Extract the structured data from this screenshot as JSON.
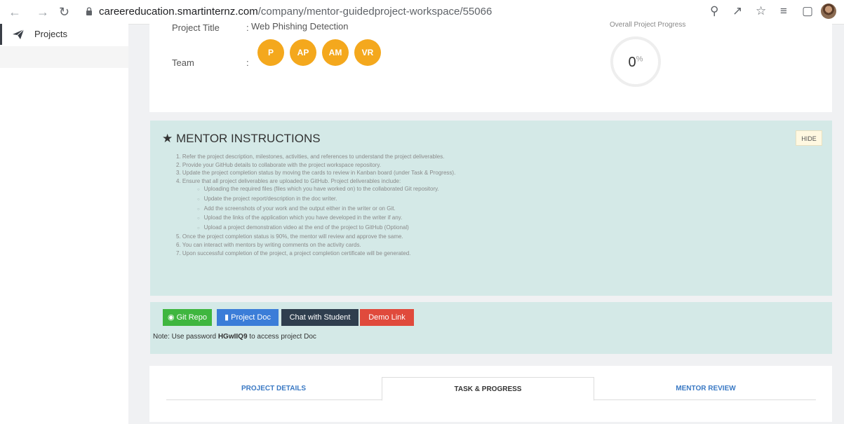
{
  "browser": {
    "url_host": "careereducation.smartinternz.com",
    "url_path": "/company/mentor-guidedproject-workspace/55066",
    "back_icon": "arrow-left-icon",
    "forward_icon": "arrow-right-icon",
    "reload_icon": "reload-icon"
  },
  "sidebar": {
    "items": [
      {
        "label": "Projects",
        "icon": "paper-plane-icon"
      }
    ]
  },
  "project": {
    "title_label": "Project Title",
    "title_value": "Web Phishing Detection",
    "team_label": "Team",
    "colon": ":",
    "team": [
      "P",
      "AP",
      "AM",
      "VR"
    ],
    "progress_label": "Overall Project Progress",
    "progress_value": "0",
    "progress_unit": "%",
    "progress_fraction": 0
  },
  "mentor": {
    "heading": "MENTOR INSTRUCTIONS",
    "hide_label": "HIDE",
    "items": [
      "1. Refer the project description, milestones, activities, and references to understand the project deliverables.",
      "2. Provide your GitHub details to collaborate with the project workspace repository.",
      "3. Update the project completion status by moving the cards to review in Kanban board (under Task & Progress).",
      "4. Ensure that all project deliverables are uploaded to GitHub. Project deliverables include:"
    ],
    "bullets": [
      "Uploading the required files (files which you have worked on) to the collaborated Git repository.",
      "Update the project report/description in the doc writer.",
      "Add the screenshots of your work and the output either in the writer or on Git.",
      "Upload the links of the application which you have developed in the writer if any.",
      "Upload a project demonstration video at the end of the project to GitHub (Optional)"
    ],
    "items_after": [
      "5. Once the project completion status is 90%, the mentor will review and approve the same.",
      "6. You can interact with mentors by writing comments on the activity cards.",
      "7. Upon successful completion of the project, a project completion certificate will be generated."
    ]
  },
  "links": {
    "git_repo": "Git Repo",
    "project_doc": "Project Doc",
    "chat": "Chat with Student",
    "demo": "Demo Link",
    "note_prefix": "Note: Use password",
    "password": "HGwIIQ9",
    "note_suffix": "to access project Doc",
    "colors": {
      "git": "#3fb63f",
      "doc": "#3b7dd8",
      "chat": "#2f3e4e",
      "demo": "#e04a3c"
    }
  },
  "tabs": [
    {
      "label": "PROJECT DETAILS",
      "active": false
    },
    {
      "label": "TASK & PROGRESS",
      "active": true
    },
    {
      "label": "MENTOR REVIEW",
      "active": false
    }
  ]
}
